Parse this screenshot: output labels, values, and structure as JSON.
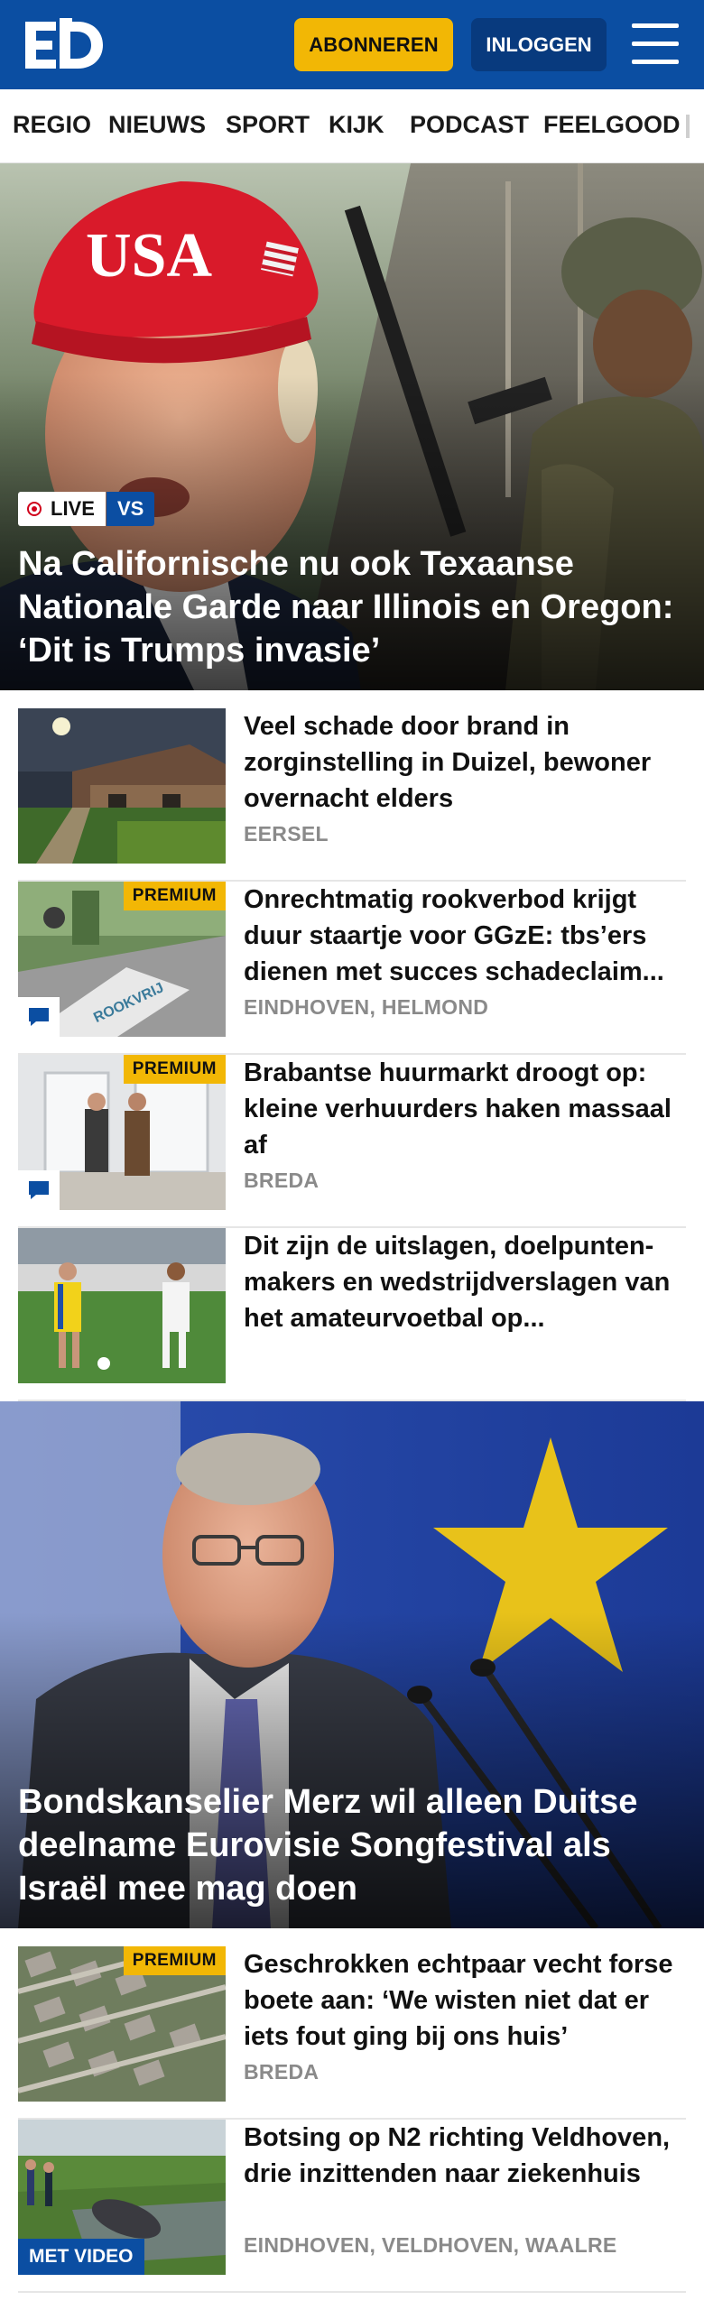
{
  "header": {
    "logo_text": "ED",
    "subscribe_label": "ABONNEREN",
    "login_label": "INLOGGEN",
    "brand_color": "#0b4ea2",
    "accent_color": "#f2b705",
    "menu_icon": "hamburger-menu-icon"
  },
  "nav": {
    "items": [
      {
        "label": "REGIO"
      },
      {
        "label": "NIEUWS"
      },
      {
        "label": "SPORT"
      },
      {
        "label": "KIJK"
      },
      {
        "label": "PODCAST"
      },
      {
        "label": "FEELGOOD"
      }
    ]
  },
  "hero1": {
    "live_label": "LIVE",
    "tag_label": "VS",
    "title": "Na Californische nu ook Texaanse Nationale Garde naar Illinois en Oregon: ‘Dit is Trumps invasie’",
    "cap_text": "USA"
  },
  "articles1": [
    {
      "title": "Veel schade door brand in zorginstelling in Duizel, bewoner overnacht elders",
      "location": "EERSEL",
      "premium": "",
      "comments": false
    },
    {
      "title": "Onrechtmatig rookverbod krijgt duur staartje voor GGzE: tbs’ers dienen met succes schadeclaim...",
      "location": "EINDHOVEN, HELMOND",
      "premium": "PREMIUM",
      "comments": true,
      "road_text": "ROOKVRIJ"
    },
    {
      "title": "Brabantse huurmarkt droogt op: kleine verhuurders haken massaal af",
      "location": "BREDA",
      "premium": "PREMIUM",
      "comments": true
    },
    {
      "title": "Dit zijn de uitslagen, doelpunten-makers en wedstrijdverslagen van het amateurvoetbal op...",
      "location": "",
      "premium": "",
      "comments": false
    }
  ],
  "hero2": {
    "title": "Bondskanselier Merz wil alleen Duitse deelname Eurovisie Songfestival als Israël mee mag doen"
  },
  "articles2": [
    {
      "title": "Geschrokken echtpaar vecht forse boete aan: ‘We wisten niet dat er iets fout ging bij ons huis’",
      "location": "BREDA",
      "premium": "PREMIUM"
    },
    {
      "title": "Botsing op N2 richting Veldhoven, drie inzittenden naar ziekenhuis",
      "location": "EINDHOVEN, VELDHOVEN, WAALRE",
      "video": "MET VIDEO"
    }
  ]
}
